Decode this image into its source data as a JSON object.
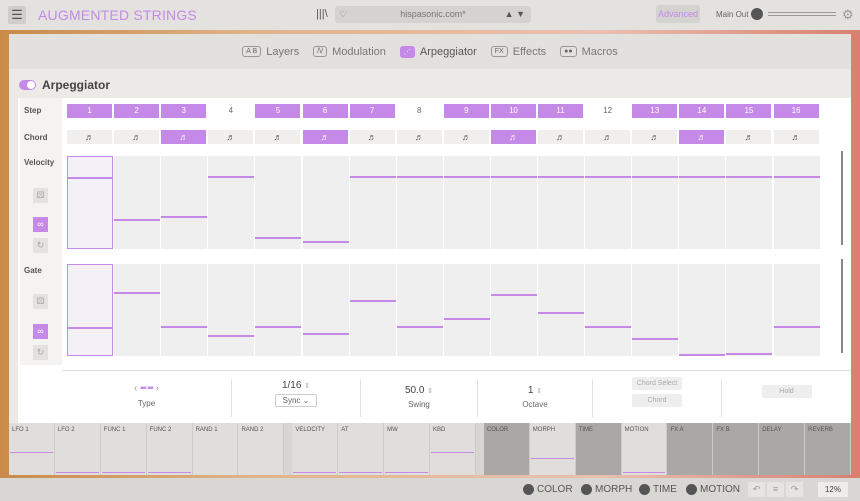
{
  "app": {
    "title": "AUGMENTED STRINGS",
    "preset": "hispasonic.com*",
    "advanced": "Advanced",
    "main_out": "Main Out"
  },
  "tabs": [
    {
      "icon": "A B",
      "label": "Layers"
    },
    {
      "icon": "/\\/",
      "label": "Modulation"
    },
    {
      "icon": "⋰",
      "label": "Arpeggiator",
      "active": true
    },
    {
      "icon": "FX",
      "label": "Effects"
    },
    {
      "icon": "●●",
      "label": "Macros"
    }
  ],
  "arp": {
    "title": "Arpeggiator",
    "labels": {
      "step": "Step",
      "chord": "Chord",
      "velocity": "Velocity",
      "gate": "Gate"
    },
    "steps": [
      {
        "n": "1",
        "on": true
      },
      {
        "n": "2",
        "on": true
      },
      {
        "n": "3",
        "on": true
      },
      {
        "n": "4",
        "on": false
      },
      {
        "n": "5",
        "on": true
      },
      {
        "n": "6",
        "on": true
      },
      {
        "n": "7",
        "on": true
      },
      {
        "n": "8",
        "on": false
      },
      {
        "n": "9",
        "on": true
      },
      {
        "n": "10",
        "on": true
      },
      {
        "n": "11",
        "on": true
      },
      {
        "n": "12",
        "on": false
      },
      {
        "n": "13",
        "on": true
      },
      {
        "n": "14",
        "on": true
      },
      {
        "n": "15",
        "on": true
      },
      {
        "n": "16",
        "on": true
      }
    ],
    "chord_on": [
      false,
      false,
      true,
      false,
      false,
      true,
      false,
      false,
      false,
      true,
      false,
      false,
      false,
      true,
      false,
      false
    ],
    "velocity": [
      0.77,
      0.31,
      0.34,
      0.77,
      0.12,
      0.08,
      0.77,
      0.77,
      0.77,
      0.77,
      0.77,
      0.77,
      0.77,
      0.77,
      0.77,
      0.77
    ],
    "gate": [
      0.32,
      0.68,
      0.32,
      0.22,
      0.32,
      0.24,
      0.6,
      0.32,
      0.4,
      0.66,
      0.47,
      0.31,
      0.18,
      0.01,
      0.02,
      0.32
    ]
  },
  "controls": {
    "type": "Type",
    "rate": "1/16",
    "sync": "Sync",
    "swing_value": "50.0",
    "swing": "Swing",
    "octave_value": "1",
    "octave": "Octave",
    "chord_select": "Chord Select",
    "chord": "Chord",
    "hold": "Hold"
  },
  "mod": [
    {
      "l": "LFO 1"
    },
    {
      "l": "LFO 2"
    },
    {
      "l": "FUNC 1"
    },
    {
      "l": "FUNC 2"
    },
    {
      "l": "RAND 1"
    },
    {
      "l": "RAND 2"
    },
    {
      "l": "VELOCITY"
    },
    {
      "l": "AT"
    },
    {
      "l": "MW"
    },
    {
      "l": "KBD"
    },
    {
      "l": "COLOR"
    },
    {
      "l": "MORPH"
    },
    {
      "l": "TIME"
    },
    {
      "l": "MOTION"
    },
    {
      "l": "FX A"
    },
    {
      "l": "FX B"
    },
    {
      "l": "DELAY"
    },
    {
      "l": "REVERB"
    }
  ],
  "status": {
    "macros": [
      "COLOR",
      "MORPH",
      "TIME",
      "MOTION"
    ],
    "zoom": "12%"
  },
  "colors": {
    "accent": "#c58ae8"
  }
}
